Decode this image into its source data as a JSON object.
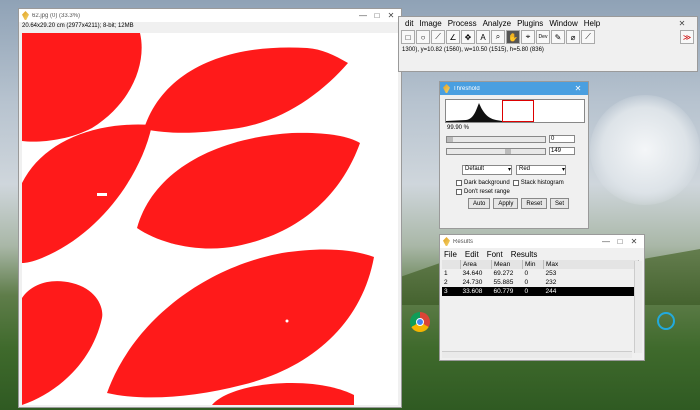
{
  "image_window": {
    "title": "62.jpg (0) (33.3%)",
    "info": "20.64x29.20 cm (2977x4211); 8-bit; 12MB"
  },
  "imagej": {
    "menus": [
      "dit",
      "Image",
      "Process",
      "Analyze",
      "Plugins",
      "Window",
      "Help"
    ],
    "tools": [
      "□",
      "○",
      "⟋",
      "∠",
      "✥",
      "A",
      "⌕",
      "✋",
      "⌖",
      "Dev",
      "✎",
      "⌀",
      "⟋",
      "≫"
    ],
    "status": "1300), y=10.82 (1560), w=10.50 (1515), h=5.80 (836)"
  },
  "threshold": {
    "title": "Threshold",
    "percent": "99.90 %",
    "min_value": "0",
    "max_value": "149",
    "method": "Default",
    "mode": "Red",
    "dark_background": "Dark background",
    "stack_histogram": "Stack histogram",
    "dont_reset": "Don't reset range",
    "buttons": [
      "Auto",
      "Apply",
      "Reset",
      "Set"
    ]
  },
  "results": {
    "title": "Results",
    "menus": [
      "File",
      "Edit",
      "Font",
      "Results"
    ],
    "columns": [
      "",
      "Area",
      "Mean",
      "Min",
      "Max"
    ],
    "rows": [
      [
        "1",
        "34.640",
        "69.272",
        "0",
        "253"
      ],
      [
        "2",
        "24.730",
        "55.885",
        "0",
        "232"
      ],
      [
        "3",
        "33.608",
        "60.779",
        "0",
        "244"
      ]
    ]
  },
  "colors": {
    "leaf": "#ff0000",
    "accent": "#4a9fe0"
  }
}
